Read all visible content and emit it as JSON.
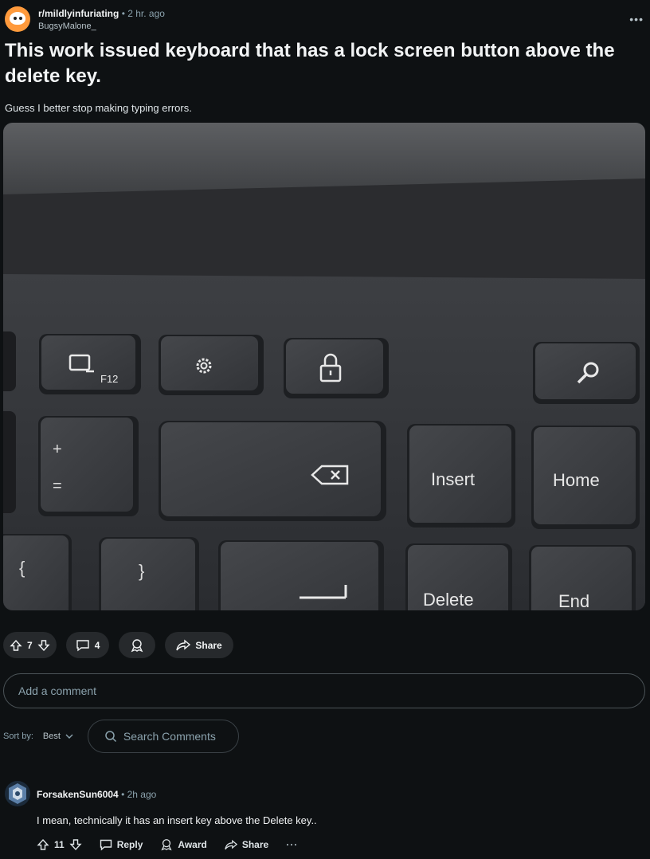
{
  "post": {
    "subreddit": "r/mildlyinfuriating",
    "time": "• 2 hr. ago",
    "author": "BugsyMalone_",
    "title": "This work issued keyboard that has a lock screen button above the delete key.",
    "body": "Guess I better stop making typing errors.",
    "image": {
      "keys": {
        "f12": "F12",
        "insert": "Insert",
        "home": "Home",
        "delete": "Delete",
        "end": "End",
        "plus": "+",
        "equals": "=",
        "brace_open": "{",
        "brace_close": "}"
      }
    },
    "votes": "7",
    "comments": "4",
    "share_label": "Share"
  },
  "comment_box": {
    "placeholder": "Add a comment"
  },
  "sort": {
    "label": "Sort by:",
    "value": "Best"
  },
  "search": {
    "placeholder": "Search Comments"
  },
  "comment": {
    "author": "ForsakenSun6004",
    "time": "• 2h ago",
    "text": "I mean, technically it has an insert key above the Delete key..",
    "votes": "11",
    "reply_label": "Reply",
    "award_label": "Award",
    "share_label": "Share",
    "more": "···"
  },
  "colors": {
    "background": "#0e1113",
    "pill": "#26292c",
    "subreddit_avatar": "#ff9a3c",
    "muted_text": "#8ba2ad"
  }
}
